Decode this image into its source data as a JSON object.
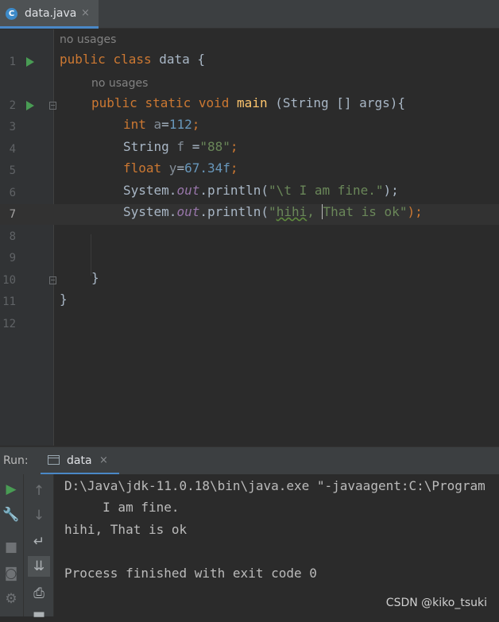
{
  "tab": {
    "label": "data.java",
    "icon": "java-class-icon",
    "close": "×",
    "icon_letter": "C"
  },
  "hints": {
    "class_usages": "no usages",
    "method_usages": "no usages"
  },
  "editor": {
    "line_numbers": [
      "1",
      "2",
      "3",
      "4",
      "5",
      "6",
      "7",
      "8",
      "9",
      "10",
      "11",
      "12"
    ],
    "current_line": 7,
    "lines": {
      "l1": {
        "public": "public",
        "class": "class",
        "name": " data {"
      },
      "l2": {
        "public": "public",
        "static": "static",
        "void": "void",
        "main": "main",
        "params": " (String [] args){"
      },
      "l3": {
        "type": "int",
        "var": " a",
        "eq": "=",
        "val": "112",
        "semi": ";"
      },
      "l4": {
        "type": "String",
        "var": " f",
        "eq": " =",
        "val": "\"88\"",
        "semi": ";"
      },
      "l5": {
        "type": "float",
        "var": " y",
        "eq": "=",
        "val": "67.34f",
        "semi": ";"
      },
      "l6": {
        "recv": "System.",
        "field": "out",
        "call": ".println(",
        "arg": "\"\\t I am fine.\"",
        "end": ");"
      },
      "l7": {
        "recv": "System.",
        "field": "out",
        "call": ".println(",
        "arg_q": "\"",
        "arg_typo": "hihi",
        "arg_mid": ", ",
        "arg_rest": "That is ok\"",
        "end": ");"
      },
      "l10": {
        "brace": "}"
      },
      "l11": {
        "brace": "}"
      }
    }
  },
  "run": {
    "label": "Run:",
    "tab_label": "data",
    "tab_close": "×",
    "console": [
      "D:\\Java\\jdk-11.0.18\\bin\\java.exe \"-javaagent:C:\\Program",
      "     I am fine.",
      "hihi, That is ok",
      "",
      "Process finished with exit code 0"
    ],
    "toolbar_left": [
      "run-icon",
      "wrench-icon",
      "stop-icon",
      "camera-icon",
      "settings-icon"
    ],
    "toolbar_right": [
      "up-arrow-icon",
      "down-arrow-icon",
      "soft-wrap-icon",
      "scroll-to-end-icon",
      "print-icon",
      "trash-icon"
    ]
  },
  "watermark": "CSDN @kiko_tsuki",
  "colors": {
    "keyword": "#cc7832",
    "string": "#6a8759",
    "number": "#6897bb",
    "function": "#ffc66d",
    "field": "#9876aa",
    "accent": "#4a88c7",
    "run_green": "#499c54"
  }
}
